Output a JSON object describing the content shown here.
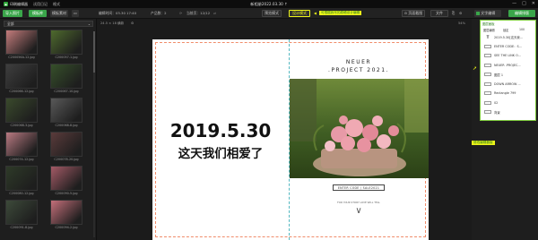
{
  "titlebar": {
    "brand": "印刷编辑器",
    "menu_items": [
      "试用日记",
      "格式"
    ],
    "doc_title": "新相册2022.03.30 ↑",
    "window_controls": [
      "—",
      "□",
      "✕"
    ]
  },
  "toolbar": {
    "import_label": "导入照片",
    "template_label": "模板库",
    "material_label": "模板素材",
    "edit_time_label": "编辑时间：03.30 17:40",
    "product_label": "产品数：2",
    "page_label": "当前页：12/12",
    "preview_label": "预览模式",
    "design_label": "设计模式",
    "annotation_top": "可根据我写的原稿设计编辑",
    "screenshot_label": "⊙ 页面截图",
    "save_label": "文件",
    "text_mode_label": "文字编辑",
    "expand_label": "编辑排版"
  },
  "sidebar": {
    "filter_value": "全部",
    "photos": [
      {
        "caption": "C200056A-12.jpg",
        "color": "#c47c7c"
      },
      {
        "caption": "C200057-1.jpg",
        "color": "#4e6a2d"
      },
      {
        "caption": "C200066-12.jpg",
        "color": "#3e3e3e"
      },
      {
        "caption": "C200067-10.jpg",
        "color": "#36502a"
      },
      {
        "caption": "C200068-3.jpg",
        "color": "#3a4a2c"
      },
      {
        "caption": "C200068-8.jpg",
        "color": "#595959"
      },
      {
        "caption": "C200074-12.jpg",
        "color": "#b97a82"
      },
      {
        "caption": "C200078-20.jpg",
        "color": "#5a3b3b"
      },
      {
        "caption": "C200080-12.jpg",
        "color": "#2e3a28"
      },
      {
        "caption": "C200090-5.jpg",
        "color": "#a45a66"
      },
      {
        "caption": "C200091-8.jpg",
        "color": "#3d4a3a"
      },
      {
        "caption": "C200094-2.jpg",
        "color": "#c46f7a"
      }
    ]
  },
  "canvas": {
    "size_label": "24.5 × 18 横款",
    "zoom_label": "54%",
    "date_text": "2019.5.30",
    "subtitle": "这天我们相爱了",
    "project_title_1": "NEUER",
    "project_title_2": ".PROJECT 2021.",
    "code_label": "ENTER CODE / SALE2021",
    "small_caption": "FOR YOUR STORY LOVE WILL TELL",
    "chevron": "∨"
  },
  "layers": {
    "header": "图层面板",
    "title": "图层编辑",
    "lock_label": "锁定",
    "opacity_label": "100",
    "items": [
      {
        "icon": "T",
        "label": "2019.5.30[这天我..."
      },
      {
        "icon": "box",
        "label": "ENTER CODE：S..."
      },
      {
        "icon": "box",
        "label": "SEE THE LINK O..."
      },
      {
        "icon": "box",
        "label": "NEUER .PROJEC..."
      },
      {
        "icon": "box",
        "label": "图层 1"
      },
      {
        "icon": "box",
        "label": "DOWN ARROW ..."
      },
      {
        "icon": "box",
        "label": "Rectangle 799"
      },
      {
        "icon": "box",
        "label": "02"
      },
      {
        "icon": "box",
        "label": "背景"
      }
    ]
  },
  "annotation_side": "修改编辑器版"
}
